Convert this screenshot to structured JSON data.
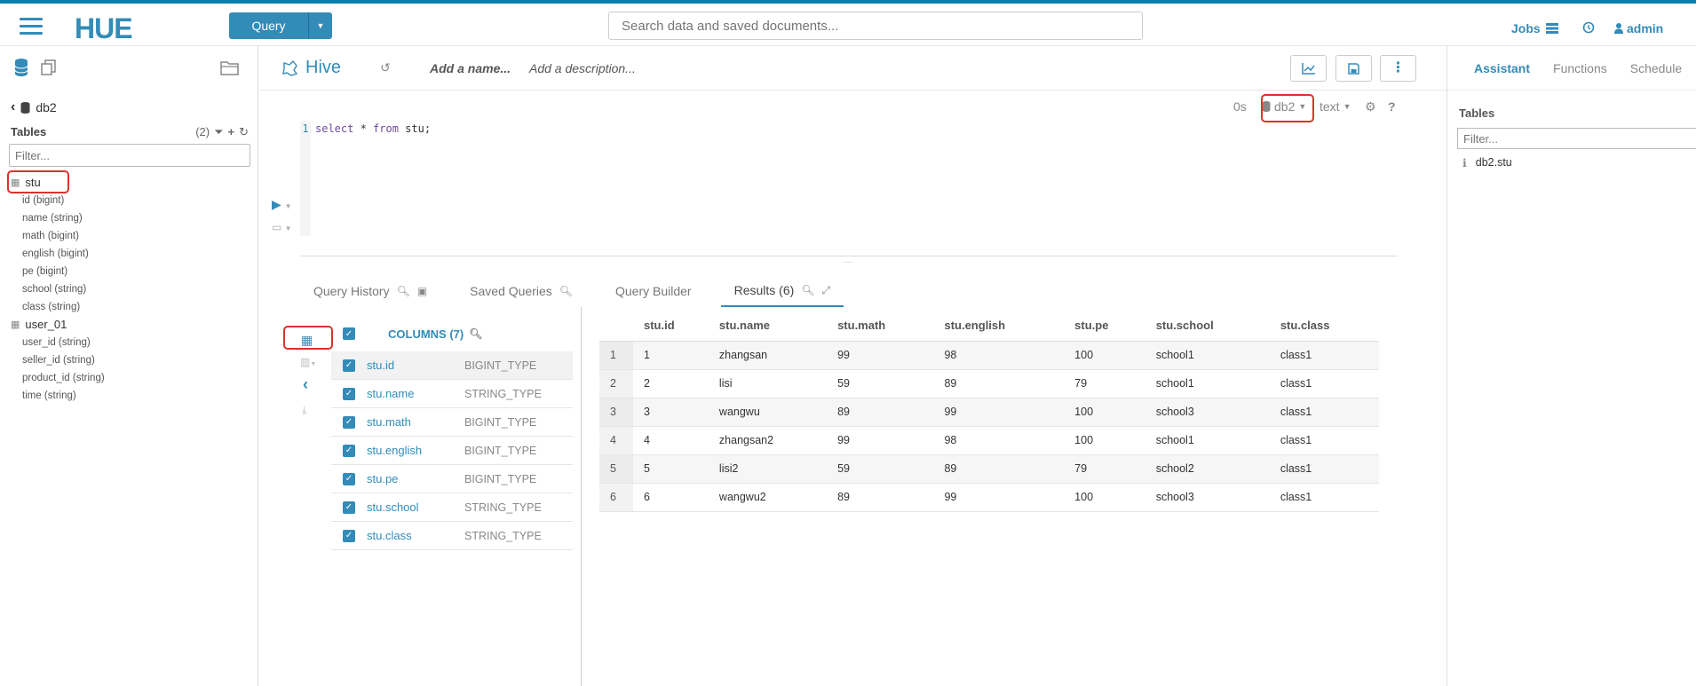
{
  "topbar": {
    "logo": "HUE",
    "query_label": "Query",
    "search_placeholder": "Search data and saved documents...",
    "jobs_label": "Jobs",
    "user_label": "admin"
  },
  "left_panel": {
    "database": "db2",
    "tables_label": "Tables",
    "tables_count": "(2)",
    "filter_placeholder": "Filter...",
    "tables": [
      {
        "name": "stu",
        "columns": [
          "id (bigint)",
          "name (string)",
          "math (bigint)",
          "english (bigint)",
          "pe (bigint)",
          "school (string)",
          "class (string)"
        ]
      },
      {
        "name": "user_01",
        "columns": [
          "user_id (string)",
          "seller_id (string)",
          "product_id (string)",
          "time (string)"
        ]
      }
    ]
  },
  "editor": {
    "engine": "Hive",
    "name_placeholder": "Add a name...",
    "description_placeholder": "Add a description...",
    "exec_time": "0s",
    "database": "db2",
    "format": "text",
    "line_number": "1",
    "code_keyword1": "select",
    "code_rest1": " * ",
    "code_keyword2": "from",
    "code_rest2": " stu;"
  },
  "tabs": {
    "history": "Query History",
    "saved": "Saved Queries",
    "builder": "Query Builder",
    "results": "Results (6)"
  },
  "columns_panel": {
    "title": "COLUMNS (7)",
    "columns": [
      {
        "name": "stu.id",
        "type": "BIGINT_TYPE"
      },
      {
        "name": "stu.name",
        "type": "STRING_TYPE"
      },
      {
        "name": "stu.math",
        "type": "BIGINT_TYPE"
      },
      {
        "name": "stu.english",
        "type": "BIGINT_TYPE"
      },
      {
        "name": "stu.pe",
        "type": "BIGINT_TYPE"
      },
      {
        "name": "stu.school",
        "type": "STRING_TYPE"
      },
      {
        "name": "stu.class",
        "type": "STRING_TYPE"
      }
    ]
  },
  "results": {
    "headers": [
      "stu.id",
      "stu.name",
      "stu.math",
      "stu.english",
      "stu.pe",
      "stu.school",
      "stu.class"
    ],
    "rows": [
      [
        "1",
        "1",
        "zhangsan",
        "99",
        "98",
        "100",
        "school1",
        "class1"
      ],
      [
        "2",
        "2",
        "lisi",
        "59",
        "89",
        "79",
        "school1",
        "class1"
      ],
      [
        "3",
        "3",
        "wangwu",
        "89",
        "99",
        "100",
        "school3",
        "class1"
      ],
      [
        "4",
        "4",
        "zhangsan2",
        "99",
        "98",
        "100",
        "school1",
        "class1"
      ],
      [
        "5",
        "5",
        "lisi2",
        "59",
        "89",
        "79",
        "school2",
        "class1"
      ],
      [
        "6",
        "6",
        "wangwu2",
        "89",
        "99",
        "100",
        "school3",
        "class1"
      ]
    ]
  },
  "right_panel": {
    "tabs": [
      "Assistant",
      "Functions",
      "Schedule"
    ],
    "tables_label": "Tables",
    "filter_placeholder": "Filter...",
    "item": "db2.stu"
  },
  "colors": {
    "accent": "#338bb8",
    "highlight": "#d9342b"
  }
}
